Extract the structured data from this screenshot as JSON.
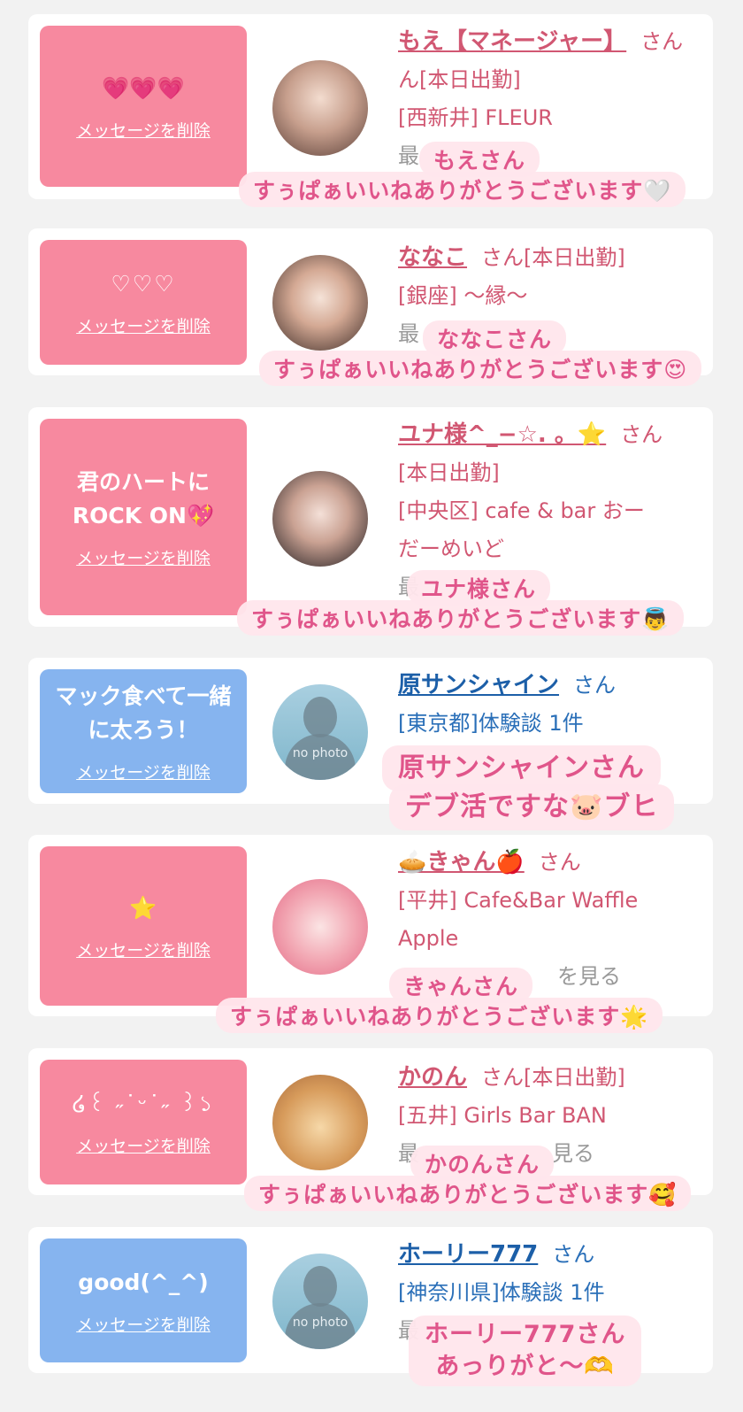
{
  "delete_label": "メッセージを削除",
  "san": "さん",
  "cards": [
    {
      "message": "💗💗💗",
      "name": "もえ【マネージャー】",
      "line1_suffix": "",
      "line2": "ん[本日出勤]",
      "line3": "[西新井] FLEUR",
      "faint": "最",
      "overlay_name": "もえさん",
      "overlay_thanks": "すぅぱぁいいねありがとうございます🤍"
    },
    {
      "message": "♡♡♡",
      "name": "ななこ",
      "line1_suffix": "[本日出勤]",
      "line2": "[銀座] 〜縁〜",
      "faint": "最",
      "overlay_name": "ななこさん",
      "overlay_thanks": "すぅぱぁいいねありがとうございます😍"
    },
    {
      "message": "君のハートに\nROCK ON💖",
      "name": "ユナ様^_−☆. 。⭐",
      "line2": "[本日出勤]",
      "line3": "[中央区] cafe & bar おー",
      "line4": "だーめいど",
      "faint": "最",
      "overlay_name": "ユナ様さん",
      "overlay_thanks": "すぅぱぁいいねありがとうございます👼"
    },
    {
      "message": "マック食べて一緒\nに太ろう！",
      "name": "原サンシャイン",
      "line2": "[東京都]体験談 1件",
      "nophoto": "no photo",
      "overlay_line1": "原サンシャインさん",
      "overlay_line2": "デブ活ですな🐷ブヒ"
    },
    {
      "message": "⭐",
      "name": "🥧きゃん🍎",
      "line2": "[平井] Cafe&Bar Waffle",
      "line3": "Apple",
      "faint": "を見る",
      "overlay_name": "きゃんさん",
      "overlay_thanks": "すぅぱぁいいねありがとうございます🌟"
    },
    {
      "message": "໒꒰ ˶˙ᵕ˙˶ ꒱১",
      "name": "かのん",
      "line1_suffix": "[本日出勤]",
      "line2": "[五井] Girls Bar BAN",
      "faint": "最",
      "faint2": "見る",
      "overlay_name": "かのんさん",
      "overlay_thanks": "すぅぱぁいいねありがとうございます🥰"
    },
    {
      "message": "good(^_^)",
      "name": "ホーリー777",
      "line2": "[神奈川県]体験談 1件",
      "nophoto": "no photo",
      "faint": "最",
      "overlay_line1": "ホーリー777さん",
      "overlay_line2": "あっりがと〜🫶"
    }
  ]
}
